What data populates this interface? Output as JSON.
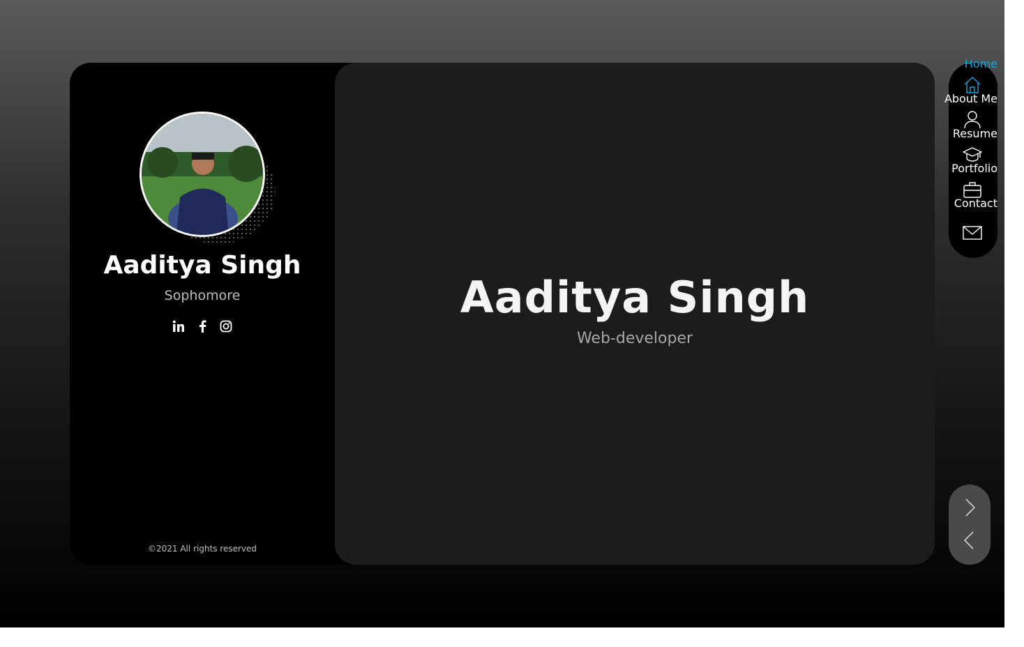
{
  "sidebar": {
    "name": "Aaditya Singh",
    "role": "Sophomore",
    "social": [
      {
        "icon": "linkedin-icon"
      },
      {
        "icon": "facebook-icon"
      },
      {
        "icon": "instagram-icon"
      }
    ],
    "copyright": "©2021 All rights reserved"
  },
  "hero": {
    "name": "Aaditya Singh",
    "role": "Web-developer"
  },
  "nav": {
    "items": [
      {
        "label": "Home",
        "icon": "home-icon",
        "active": true
      },
      {
        "label": "About Me",
        "icon": "user-icon",
        "active": false
      },
      {
        "label": "Resume",
        "icon": "graduation-cap-icon",
        "active": false
      },
      {
        "label": "Portfolio",
        "icon": "briefcase-icon",
        "active": false
      },
      {
        "label": "Contact",
        "icon": "envelope-icon",
        "active": false
      }
    ]
  },
  "pager": {
    "next_icon": "chevron-right-icon",
    "prev_icon": "chevron-left-icon"
  },
  "colors": {
    "accent": "#1aa3d9",
    "card_bg": "#000000",
    "main_bg": "#1c1c1c",
    "pager_bg": "#4a4a4a"
  }
}
